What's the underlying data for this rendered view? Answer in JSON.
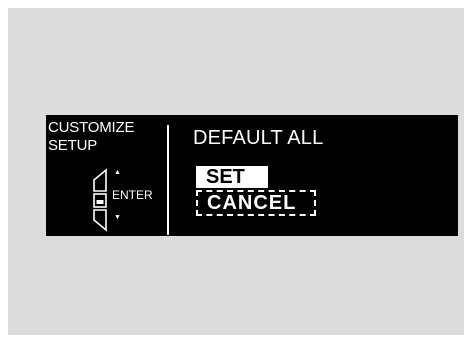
{
  "display": {
    "left_title_line1": "CUSTOMIZE",
    "left_title_line2": "SETUP",
    "enter_label": "ENTER",
    "up_arrow": "▲",
    "down_arrow": "▼",
    "main_title": "DEFAULT ALL",
    "options": [
      {
        "label": "SET",
        "selected": true
      },
      {
        "label": "CANCEL",
        "selected": false
      }
    ]
  },
  "colors": {
    "panel_background": "#dcdcdc",
    "display_background": "#000000",
    "display_text": "#ffffff"
  },
  "icons": {
    "knob": "interface-dial-icon"
  }
}
